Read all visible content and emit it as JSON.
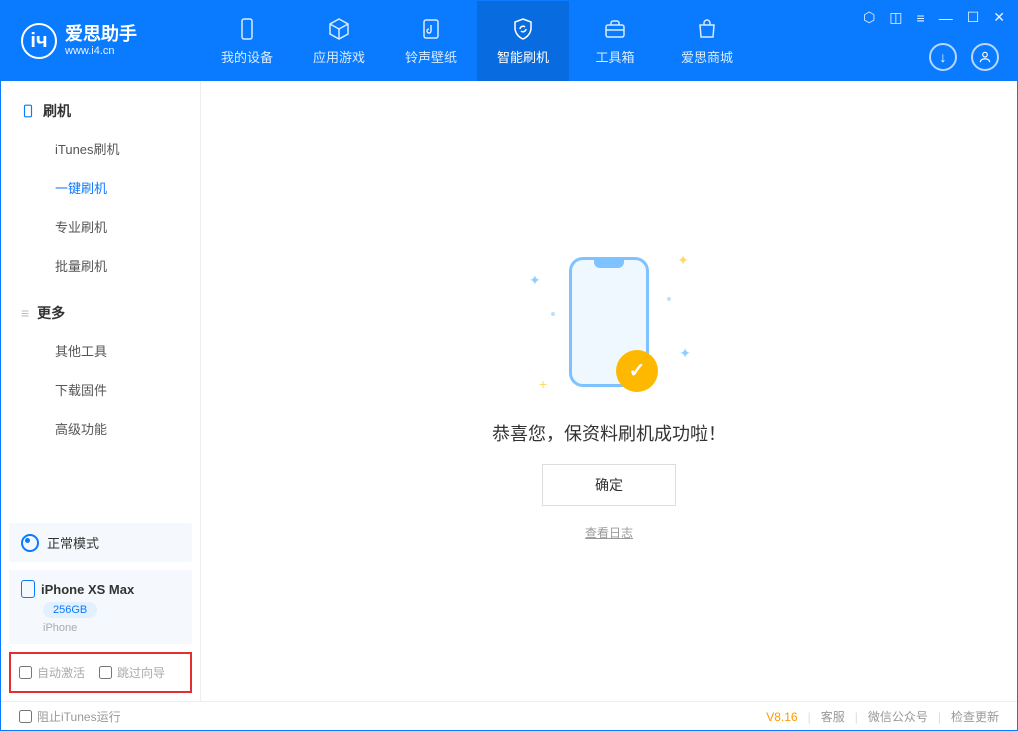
{
  "logo": {
    "title": "爱思助手",
    "subtitle": "www.i4.cn",
    "glyph": "iч"
  },
  "nav": {
    "tabs": [
      {
        "label": "我的设备"
      },
      {
        "label": "应用游戏"
      },
      {
        "label": "铃声壁纸"
      },
      {
        "label": "智能刷机"
      },
      {
        "label": "工具箱"
      },
      {
        "label": "爱思商城"
      }
    ]
  },
  "sidebar": {
    "section_flash": "刷机",
    "items_flash": [
      "iTunes刷机",
      "一键刷机",
      "专业刷机",
      "批量刷机"
    ],
    "section_more": "更多",
    "items_more": [
      "其他工具",
      "下载固件",
      "高级功能"
    ]
  },
  "device_mode": {
    "label": "正常模式"
  },
  "device": {
    "name": "iPhone XS Max",
    "storage": "256GB",
    "type": "iPhone"
  },
  "options": {
    "auto_activate": "自动激活",
    "skip_guide": "跳过向导"
  },
  "main": {
    "success_text": "恭喜您，保资料刷机成功啦！",
    "ok_button": "确定",
    "view_log": "查看日志"
  },
  "footer": {
    "block_itunes": "阻止iTunes运行",
    "version": "V8.16",
    "service": "客服",
    "wechat": "微信公众号",
    "check_update": "检查更新"
  }
}
